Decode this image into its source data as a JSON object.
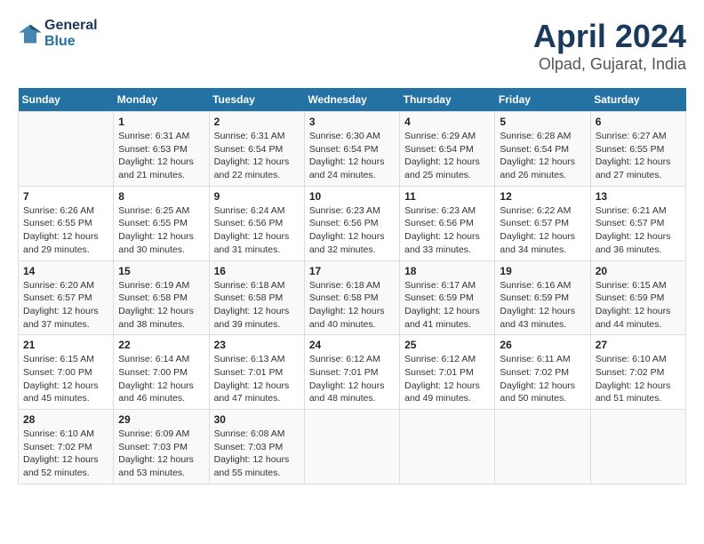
{
  "header": {
    "logo_line1": "General",
    "logo_line2": "Blue",
    "title": "April 2024",
    "subtitle": "Olpad, Gujarat, India"
  },
  "weekdays": [
    "Sunday",
    "Monday",
    "Tuesday",
    "Wednesday",
    "Thursday",
    "Friday",
    "Saturday"
  ],
  "weeks": [
    [
      {
        "day": "",
        "info": ""
      },
      {
        "day": "1",
        "info": "Sunrise: 6:31 AM\nSunset: 6:53 PM\nDaylight: 12 hours\nand 21 minutes."
      },
      {
        "day": "2",
        "info": "Sunrise: 6:31 AM\nSunset: 6:54 PM\nDaylight: 12 hours\nand 22 minutes."
      },
      {
        "day": "3",
        "info": "Sunrise: 6:30 AM\nSunset: 6:54 PM\nDaylight: 12 hours\nand 24 minutes."
      },
      {
        "day": "4",
        "info": "Sunrise: 6:29 AM\nSunset: 6:54 PM\nDaylight: 12 hours\nand 25 minutes."
      },
      {
        "day": "5",
        "info": "Sunrise: 6:28 AM\nSunset: 6:54 PM\nDaylight: 12 hours\nand 26 minutes."
      },
      {
        "day": "6",
        "info": "Sunrise: 6:27 AM\nSunset: 6:55 PM\nDaylight: 12 hours\nand 27 minutes."
      }
    ],
    [
      {
        "day": "7",
        "info": "Sunrise: 6:26 AM\nSunset: 6:55 PM\nDaylight: 12 hours\nand 29 minutes."
      },
      {
        "day": "8",
        "info": "Sunrise: 6:25 AM\nSunset: 6:55 PM\nDaylight: 12 hours\nand 30 minutes."
      },
      {
        "day": "9",
        "info": "Sunrise: 6:24 AM\nSunset: 6:56 PM\nDaylight: 12 hours\nand 31 minutes."
      },
      {
        "day": "10",
        "info": "Sunrise: 6:23 AM\nSunset: 6:56 PM\nDaylight: 12 hours\nand 32 minutes."
      },
      {
        "day": "11",
        "info": "Sunrise: 6:23 AM\nSunset: 6:56 PM\nDaylight: 12 hours\nand 33 minutes."
      },
      {
        "day": "12",
        "info": "Sunrise: 6:22 AM\nSunset: 6:57 PM\nDaylight: 12 hours\nand 34 minutes."
      },
      {
        "day": "13",
        "info": "Sunrise: 6:21 AM\nSunset: 6:57 PM\nDaylight: 12 hours\nand 36 minutes."
      }
    ],
    [
      {
        "day": "14",
        "info": "Sunrise: 6:20 AM\nSunset: 6:57 PM\nDaylight: 12 hours\nand 37 minutes."
      },
      {
        "day": "15",
        "info": "Sunrise: 6:19 AM\nSunset: 6:58 PM\nDaylight: 12 hours\nand 38 minutes."
      },
      {
        "day": "16",
        "info": "Sunrise: 6:18 AM\nSunset: 6:58 PM\nDaylight: 12 hours\nand 39 minutes."
      },
      {
        "day": "17",
        "info": "Sunrise: 6:18 AM\nSunset: 6:58 PM\nDaylight: 12 hours\nand 40 minutes."
      },
      {
        "day": "18",
        "info": "Sunrise: 6:17 AM\nSunset: 6:59 PM\nDaylight: 12 hours\nand 41 minutes."
      },
      {
        "day": "19",
        "info": "Sunrise: 6:16 AM\nSunset: 6:59 PM\nDaylight: 12 hours\nand 43 minutes."
      },
      {
        "day": "20",
        "info": "Sunrise: 6:15 AM\nSunset: 6:59 PM\nDaylight: 12 hours\nand 44 minutes."
      }
    ],
    [
      {
        "day": "21",
        "info": "Sunrise: 6:15 AM\nSunset: 7:00 PM\nDaylight: 12 hours\nand 45 minutes."
      },
      {
        "day": "22",
        "info": "Sunrise: 6:14 AM\nSunset: 7:00 PM\nDaylight: 12 hours\nand 46 minutes."
      },
      {
        "day": "23",
        "info": "Sunrise: 6:13 AM\nSunset: 7:01 PM\nDaylight: 12 hours\nand 47 minutes."
      },
      {
        "day": "24",
        "info": "Sunrise: 6:12 AM\nSunset: 7:01 PM\nDaylight: 12 hours\nand 48 minutes."
      },
      {
        "day": "25",
        "info": "Sunrise: 6:12 AM\nSunset: 7:01 PM\nDaylight: 12 hours\nand 49 minutes."
      },
      {
        "day": "26",
        "info": "Sunrise: 6:11 AM\nSunset: 7:02 PM\nDaylight: 12 hours\nand 50 minutes."
      },
      {
        "day": "27",
        "info": "Sunrise: 6:10 AM\nSunset: 7:02 PM\nDaylight: 12 hours\nand 51 minutes."
      }
    ],
    [
      {
        "day": "28",
        "info": "Sunrise: 6:10 AM\nSunset: 7:02 PM\nDaylight: 12 hours\nand 52 minutes."
      },
      {
        "day": "29",
        "info": "Sunrise: 6:09 AM\nSunset: 7:03 PM\nDaylight: 12 hours\nand 53 minutes."
      },
      {
        "day": "30",
        "info": "Sunrise: 6:08 AM\nSunset: 7:03 PM\nDaylight: 12 hours\nand 55 minutes."
      },
      {
        "day": "",
        "info": ""
      },
      {
        "day": "",
        "info": ""
      },
      {
        "day": "",
        "info": ""
      },
      {
        "day": "",
        "info": ""
      }
    ]
  ]
}
